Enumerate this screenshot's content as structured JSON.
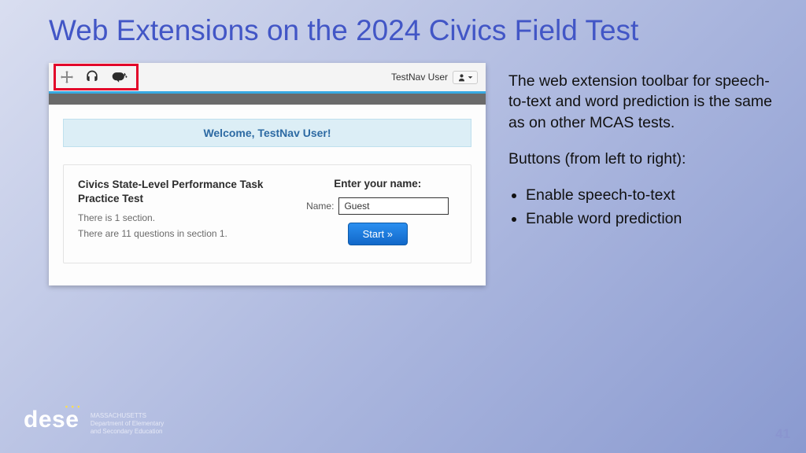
{
  "title": "Web Extensions on the 2024 Civics Field Test",
  "screenshot": {
    "toolbar_icons": [
      "move-icon",
      "headset-icon",
      "word-prediction-icon"
    ],
    "user_label": "TestNav User",
    "welcome": "Welcome, TestNav User!",
    "test_title": "Civics State-Level Performance Task Practice Test",
    "section_line": "There is 1 section.",
    "questions_line": "There are 11 questions in section 1.",
    "enter_name": "Enter your name:",
    "name_label": "Name:",
    "name_value": "Guest",
    "start_label": "Start »"
  },
  "explain": {
    "p1": "The web extension toolbar for speech-to-text and word prediction is the same as on other MCAS tests.",
    "p2": "Buttons (from left to right):",
    "bullets": [
      "Enable speech-to-text",
      "Enable word prediction"
    ]
  },
  "logo": {
    "brand": "dese",
    "line1": "MASSACHUSETTS",
    "line2": "Department of Elementary",
    "line3": "and Secondary Education"
  },
  "page_number": "41"
}
